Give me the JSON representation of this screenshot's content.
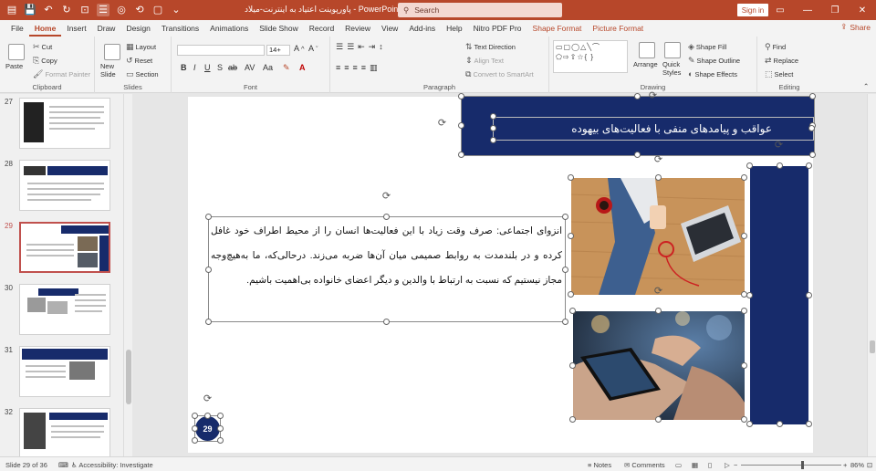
{
  "window": {
    "doc_title": "پاورپوینت اعتیاد به اینترنت-میلاد",
    "app_name": "PowerPoint",
    "search_placeholder": "Search",
    "signin_label": "Sign in"
  },
  "tabs": [
    "File",
    "Home",
    "Insert",
    "Draw",
    "Design",
    "Transitions",
    "Animations",
    "Slide Show",
    "Record",
    "Review",
    "View",
    "Add-ins",
    "Help",
    "Nitro PDF Pro",
    "Shape Format",
    "Picture Format"
  ],
  "active_tab": "Home",
  "share_label": "Share",
  "ribbon": {
    "clipboard": {
      "paste": "Paste",
      "cut": "Cut",
      "copy": "Copy",
      "format_painter": "Format Painter",
      "label": "Clipboard"
    },
    "slides": {
      "new_slide": "New Slide",
      "layout": "Layout",
      "reset": "Reset",
      "section": "Section",
      "label": "Slides"
    },
    "font": {
      "size": "14+",
      "label": "Font"
    },
    "paragraph": {
      "text_direction": "Text Direction",
      "align_text": "Align Text",
      "convert_smartart": "Convert to SmartArt",
      "label": "Paragraph"
    },
    "drawing": {
      "arrange": "Arrange",
      "quick_styles": "Quick Styles",
      "shape_fill": "Shape Fill",
      "shape_outline": "Shape Outline",
      "shape_effects": "Shape Effects",
      "label": "Drawing"
    },
    "editing": {
      "find": "Find",
      "replace": "Replace",
      "select": "Select",
      "label": "Editing"
    }
  },
  "thumbnails": [
    {
      "num": "27"
    },
    {
      "num": "28"
    },
    {
      "num": "29"
    },
    {
      "num": "30"
    },
    {
      "num": "31"
    },
    {
      "num": "32"
    }
  ],
  "slide": {
    "title": "عواقب و پیامدهای منفی با فعالیت‌های بیهوده",
    "body": "انزوای اجتماعی: صرف وقت زیاد با این فعالیت‌ها انسان را از محیط اطراف خود غافل کرده و در بلندمدت به روابط صمیمی میان آن‌ها ضربه می‌زند. درحالی‌که، ما به‌هیچ‌وجه مجاز نیستیم که نسبت به ارتباط با والدین و دیگر اعضای خانواده بی‌اهمیت باشیم.",
    "number": "29"
  },
  "status": {
    "slide_info": "Slide 29 of 36",
    "accessibility": "Accessibility: Investigate",
    "notes": "Notes",
    "comments": "Comments",
    "zoom": "86%"
  },
  "colors": {
    "brand": "#b7472a",
    "navy": "#172b6b"
  }
}
